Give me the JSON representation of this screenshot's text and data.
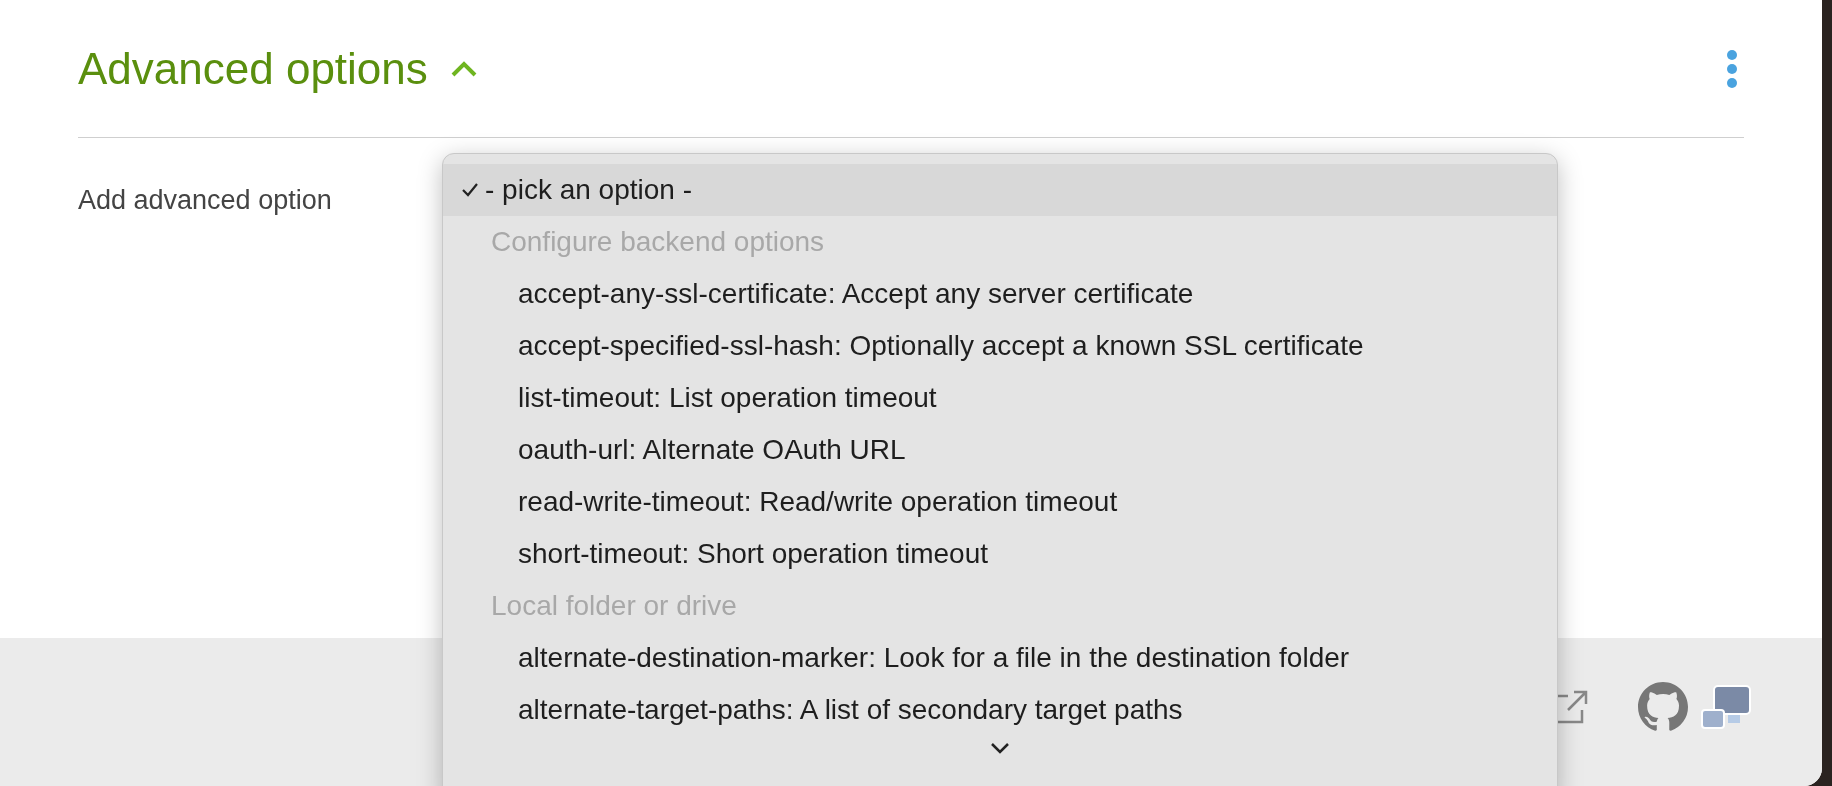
{
  "section": {
    "title": "Advanced options",
    "expanded": true
  },
  "field": {
    "label": "Add advanced option"
  },
  "menu": {
    "items": [
      {
        "kind": "option",
        "label": "- pick an option -",
        "selected": true
      },
      {
        "kind": "group",
        "label": "Configure backend options",
        "children": [
          {
            "kind": "option",
            "label": "accept-any-ssl-certificate: Accept any server certificate",
            "selected": false
          },
          {
            "kind": "option",
            "label": "accept-specified-ssl-hash: Optionally accept a known SSL certificate",
            "selected": false
          },
          {
            "kind": "option",
            "label": "list-timeout: List operation timeout",
            "selected": false
          },
          {
            "kind": "option",
            "label": "oauth-url: Alternate OAuth URL",
            "selected": false
          },
          {
            "kind": "option",
            "label": "read-write-timeout: Read/write operation timeout",
            "selected": false
          },
          {
            "kind": "option",
            "label": "short-timeout: Short operation timeout",
            "selected": false
          }
        ]
      },
      {
        "kind": "group",
        "label": "Local folder or drive",
        "children": [
          {
            "kind": "option",
            "label": "alternate-destination-marker: Look for a file in the destination folder",
            "selected": false
          },
          {
            "kind": "option",
            "label": "alternate-target-paths: A list of secondary target paths",
            "selected": false
          }
        ]
      }
    ]
  }
}
